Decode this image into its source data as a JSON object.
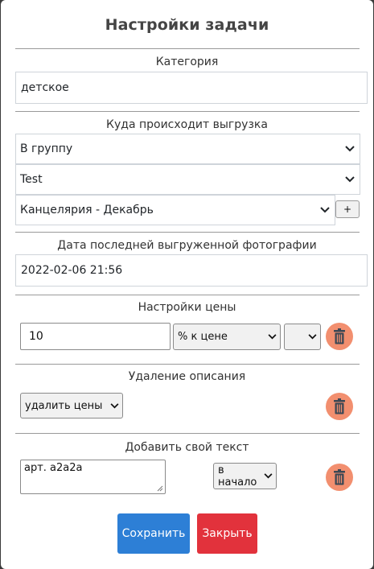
{
  "dialog": {
    "title": "Настройки задачи"
  },
  "category": {
    "label": "Категория",
    "value": "детское"
  },
  "export": {
    "label": "Куда происходит выгрузка",
    "target_type": "В группу",
    "account": "Test",
    "album": "Канцелярия - Декабрь",
    "add_label": "+"
  },
  "last_photo": {
    "label": "Дата последней выгруженной фотографии",
    "value": "2022-02-06 21:56"
  },
  "price": {
    "label": "Настройки цены",
    "amount": "10",
    "mode": "% к цене",
    "extra": ""
  },
  "description_removal": {
    "label": "Удаление описания",
    "mode": "удалить цены"
  },
  "custom_text": {
    "label": "Добавить свой текст",
    "text": "арт. a2a2a",
    "position": "в начало"
  },
  "buttons": {
    "save": "Сохранить",
    "close": "Закрыть"
  },
  "colors": {
    "save": "#2d7fd6",
    "close": "#e2323c",
    "trash_bg": "#f28f6f",
    "trash_icon": "#3b4754"
  },
  "icons": {
    "trash": "trash-icon",
    "chevron": "chevron-down-icon",
    "resize": "resize-grip-icon"
  }
}
